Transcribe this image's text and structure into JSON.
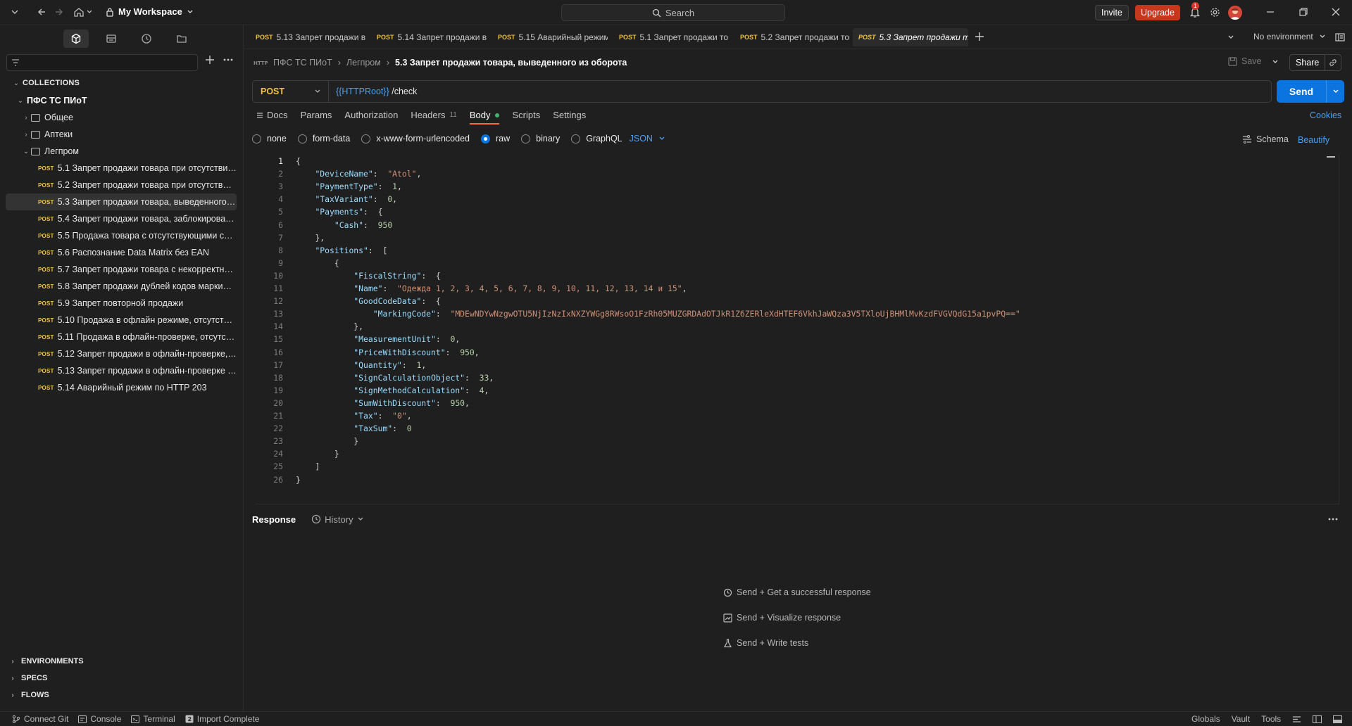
{
  "titlebar": {
    "workspace": "My Workspace",
    "search_placeholder": "Search",
    "invite_label": "Invite",
    "upgrade_label": "Upgrade",
    "notification_count": "1"
  },
  "sidebar": {
    "collections_label": "COLLECTIONS",
    "collection_name": "ПФС ТС ПИоТ",
    "folders": [
      "Общее",
      "Аптеки",
      "Легпром"
    ],
    "method": "POST",
    "requests": [
      "5.1 Запрет продажи товара при отсутствии…",
      "5.2 Запрет продажи товара при отсутств…",
      "5.3 Запрет продажи товара, выведенного…",
      "5.4 Запрет продажи товара, заблокирова…",
      "5.5 Продажа товара с отсутствующими с…",
      "5.6 Распознание Data Matrix без EAN",
      "5.7 Запрет продажи товара с некорректн…",
      "5.8 Запрет продажи дублей кодов марки…",
      "5.9 Запрет повторной продажи",
      "5.10 Продажа в офлайн режиме, отсутств…",
      "5.11 Продажа в офлайн-проверке, отсутст…",
      "5.12 Запрет продажи в офлайн-проверке,…",
      "5.13 Запрет продажи в офлайн-проверке …",
      "5.14 Аварийный режим по HTTP 203"
    ],
    "bottom_sections": [
      "ENVIRONMENTS",
      "SPECS",
      "FLOWS"
    ]
  },
  "tabs": [
    {
      "method": "POST",
      "label": "5.13 Запрет продажи в"
    },
    {
      "method": "POST",
      "label": "5.14 Запрет продажи в"
    },
    {
      "method": "POST",
      "label": "5.15 Аварийный режим"
    },
    {
      "method": "POST",
      "label": "5.1 Запрет продажи тов"
    },
    {
      "method": "POST",
      "label": "5.2 Запрет продажи тов"
    },
    {
      "method": "POST",
      "label": "5.3 Запрет продажи тов"
    }
  ],
  "environment": "No environment",
  "breadcrumb": {
    "collection": "ПФС ТС ПИоТ",
    "folder": "Легпром",
    "current": "5.3 Запрет продажи товара, выведенного из оборота"
  },
  "actions": {
    "save": "Save",
    "share": "Share"
  },
  "request": {
    "method": "POST",
    "url_var": "{{HTTPRoot}}",
    "url_path": " /check",
    "send": "Send"
  },
  "request_tabs": {
    "docs": "Docs",
    "params": "Params",
    "authorization": "Authorization",
    "headers": "Headers",
    "headers_count": "11",
    "body": "Body",
    "scripts": "Scripts",
    "settings": "Settings",
    "cookies": "Cookies"
  },
  "body_types": {
    "none": "none",
    "form_data": "form-data",
    "urlencoded": "x-www-form-urlencoded",
    "raw": "raw",
    "binary": "binary",
    "graphql": "GraphQL",
    "format": "JSON",
    "schema": "Schema",
    "beautify": "Beautify"
  },
  "code_lines": [
    "{",
    "    \"DeviceName\":  \"Atol\",",
    "    \"PaymentType\":  1,",
    "    \"TaxVariant\":  0,",
    "    \"Payments\":  {",
    "        \"Cash\":  950",
    "    },",
    "    \"Positions\":  [",
    "        {",
    "            \"FiscalString\":  {",
    "            \"Name\":  \"Одежда 1, 2, 3, 4, 5, 6, 7, 8, 9, 10, 11, 12, 13, 14 и 15\",",
    "            \"GoodCodeData\":  {",
    "                \"MarkingCode\":  \"MDEwNDYwNzgwOTU5NjIzNzIxNXZYWGg8RWsoO1FzRh05MUZGRDAdOTJkR1Z6ZERleXdHTEF6VkhJaWQza3V5TXloUjBHMlMvKzdFVGVQdG15a1pvPQ==\"",
    "            },",
    "            \"MeasurementUnit\":  0,",
    "            \"PriceWithDiscount\":  950,",
    "            \"Quantity\":  1,",
    "            \"SignCalculationObject\":  33,",
    "            \"SignMethodCalculation\":  4,",
    "            \"SumWithDiscount\":  950,",
    "            \"Tax\":  \"0\",",
    "            \"TaxSum\":  0",
    "            }",
    "        }",
    "    ]",
    "}"
  ],
  "response": {
    "label": "Response",
    "history": "History",
    "hints": [
      "Send + Get a successful response",
      "Send + Visualize response",
      "Send + Write tests"
    ]
  },
  "statusbar": {
    "connect_git": "Connect Git",
    "console": "Console",
    "terminal": "Terminal",
    "import": "Import Complete",
    "globals": "Globals",
    "vault": "Vault",
    "tools": "Tools"
  },
  "colors": {
    "accent": "#ff6c37",
    "send": "#0b74de",
    "method_post": "#f0c24a",
    "upgrade": "#c6371c"
  }
}
